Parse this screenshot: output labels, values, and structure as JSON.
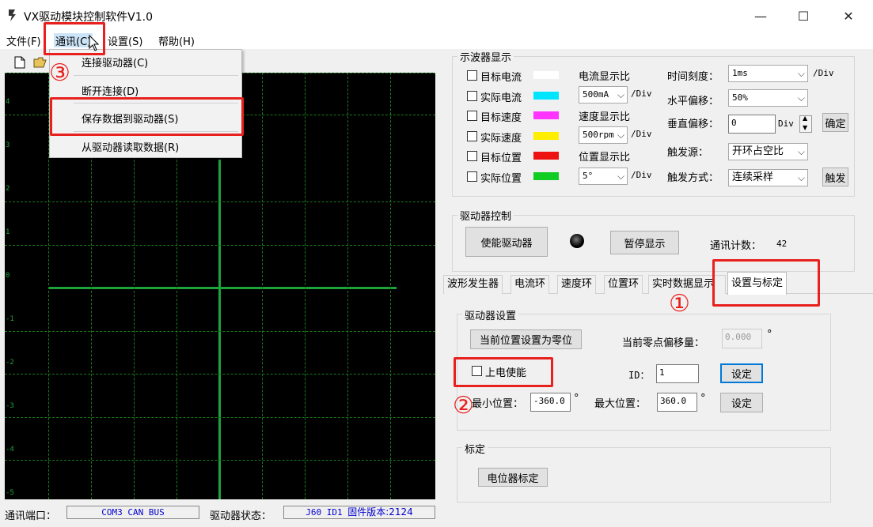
{
  "window": {
    "title": "VX驱动模块控制软件V1.0",
    "minimize": "—",
    "maximize": "☐",
    "close": "✕"
  },
  "menubar": {
    "file": "文件(F)",
    "comm": "通讯(C)",
    "settings": "设置(S)",
    "help": "帮助(H)"
  },
  "dropdown": {
    "connect": "连接驱动器(C)",
    "disconnect": "断开连接(D)",
    "save": "保存数据到驱动器(S)",
    "read": "从驱动器读取数据(R)"
  },
  "scope_y_ticks": [
    "4",
    "3",
    "2",
    "1",
    "0",
    "-1",
    "-2",
    "-3",
    "-4",
    "-5"
  ],
  "statusbar": {
    "port_label": "通讯端口：",
    "port_value": "COM3 CAN BUS",
    "state_label": "驱动器状态：",
    "state_value_prefix": "J60 ID1",
    "state_value_fw": "固件版本:2124"
  },
  "oscilloscope": {
    "group_title": "示波器显示",
    "channels": [
      {
        "label": "目标电流",
        "color": "#ffffff"
      },
      {
        "label": "实际电流",
        "color": "#00e5ff"
      },
      {
        "label": "目标速度",
        "color": "#ff33ff"
      },
      {
        "label": "实际速度",
        "color": "#ffee00"
      },
      {
        "label": "目标位置",
        "color": "#ee1111"
      },
      {
        "label": "实际位置",
        "color": "#11cc22"
      }
    ],
    "current_scale_label": "电流显示比",
    "current_scale_value": "500mA",
    "speed_scale_label": "速度显示比",
    "speed_scale_value": "500rpm",
    "pos_scale_label": "位置显示比",
    "pos_scale_value": "5°",
    "per_div": "/Div",
    "time_label": "时间刻度：",
    "time_value": "1ms",
    "hoffset_label": "水平偏移：",
    "hoffset_value": "50%",
    "voffset_label": "垂直偏移：",
    "voffset_value": "0",
    "div_unit": "Div",
    "confirm_button": "确定",
    "trigger_src_label": "触发源：",
    "trigger_src_value": "开环占空比",
    "trigger_mode_label": "触发方式：",
    "trigger_mode_value": "连续采样",
    "trigger_button": "触发"
  },
  "driver_control": {
    "group_title": "驱动器控制",
    "enable_button": "使能驱动器",
    "pause_button": "暂停显示",
    "count_label": "通讯计数：",
    "count_value": "42"
  },
  "tabs": [
    "波形发生器",
    "电流环",
    "速度环",
    "位置环",
    "实时数据显示",
    "设置与标定"
  ],
  "settings": {
    "group_title": "驱动器设置",
    "set_zero_button": "当前位置设置为零位",
    "zero_offset_label": "当前零点偏移量：",
    "zero_offset_value": "0.000",
    "degree": "°",
    "power_enable_label": "上电使能",
    "id_label": "ID：",
    "id_value": "1",
    "set_button": "设定",
    "min_pos_label": "最小位置：",
    "min_pos_value": "-360.0",
    "max_pos_label": "最大位置：",
    "max_pos_value": "360.0"
  },
  "calibration": {
    "group_title": "标定",
    "pot_button": "电位器标定"
  },
  "annotations": {
    "one": "①",
    "two": "②",
    "three": "③",
    "color": "#e8201e"
  }
}
